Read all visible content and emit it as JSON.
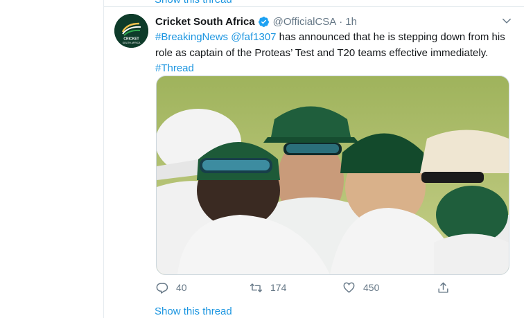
{
  "previous_tweet": {
    "show_thread_label": "Show this thread"
  },
  "tweet": {
    "author_name": "Cricket South Africa",
    "handle": "@OfficialCSA",
    "separator": "·",
    "time": "1h",
    "text": {
      "hashtag1": "#BreakingNews",
      "mention": "@faf1307",
      "body": " has announced that he is stepping down from his role as captain of the Proteas’ Test and T20 teams effective immediately.",
      "hashtag2": "#Thread"
    },
    "actions": {
      "reply_count": "40",
      "retweet_count": "174",
      "like_count": "450"
    },
    "show_thread_label": "Show this thread"
  },
  "avatar": {
    "logo_text_1": "CRICKET",
    "logo_text_2": "SOUTH AFRICA"
  },
  "icons": {
    "verified": "verified-badge-icon",
    "caret": "chevron-down-icon",
    "reply": "reply-icon",
    "retweet": "retweet-icon",
    "like": "heart-icon",
    "share": "share-icon"
  },
  "colors": {
    "link": "#1b95e0",
    "muted": "#657786",
    "border": "#e6ecf0",
    "avatar_bg": "#0e3b2a"
  }
}
